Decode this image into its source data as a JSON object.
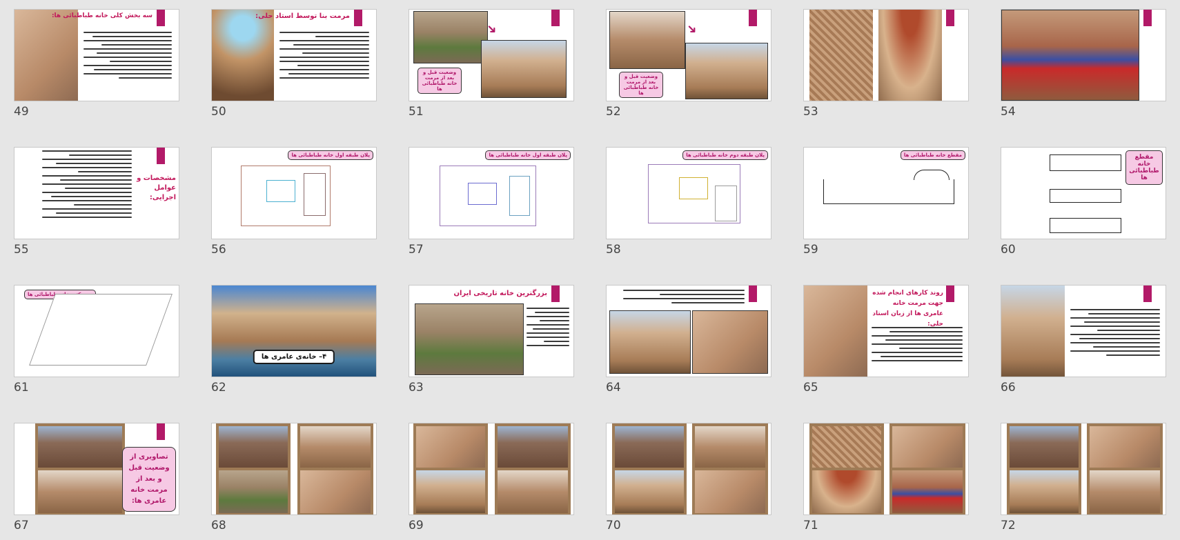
{
  "slides": [
    {
      "n": "49",
      "title": "سه بخش کلی خانه طباطبائی ها:"
    },
    {
      "n": "50",
      "title": "مرمت بنا توسط استاد حلی:"
    },
    {
      "n": "51",
      "callout": "وضعیت قبل و بعد از مرمت خانه طباطبائی ها"
    },
    {
      "n": "52",
      "callout": "وضعیت قبل و بعد از مرمت خانه طباطبائی ها"
    },
    {
      "n": "53"
    },
    {
      "n": "54"
    },
    {
      "n": "55",
      "title": "مشخصات و عوامل اجرایی:"
    },
    {
      "n": "56",
      "label": "پلان طبقه اول خانه طباطبائی ها"
    },
    {
      "n": "57",
      "label": "پلان طبقه اول خانه طباطبائی ها"
    },
    {
      "n": "58",
      "label": "پلان طبقه دوم خانه طباطبائی ها"
    },
    {
      "n": "59",
      "label": "مقطع خانه طباطبائی ها"
    },
    {
      "n": "60",
      "label": "مقطع خانه طباطبائی ها"
    },
    {
      "n": "61",
      "label": "پرسپکتیو خانه طباطبائی ها"
    },
    {
      "n": "62",
      "caption": "۴– خانه‌ی عامری ها"
    },
    {
      "n": "63",
      "title": "بزرگترین خانه تاریخی ایران"
    },
    {
      "n": "64"
    },
    {
      "n": "65",
      "title": "روند کارهای انجام شده جهت مرمت خانه عامری ها از زبان استاد حلی:"
    },
    {
      "n": "66"
    },
    {
      "n": "67",
      "callout": "تصاویری از وضعیت قبل و بعد از مرمت خانه عامری ها:"
    },
    {
      "n": "68"
    },
    {
      "n": "69"
    },
    {
      "n": "70"
    },
    {
      "n": "71"
    },
    {
      "n": "72"
    }
  ]
}
